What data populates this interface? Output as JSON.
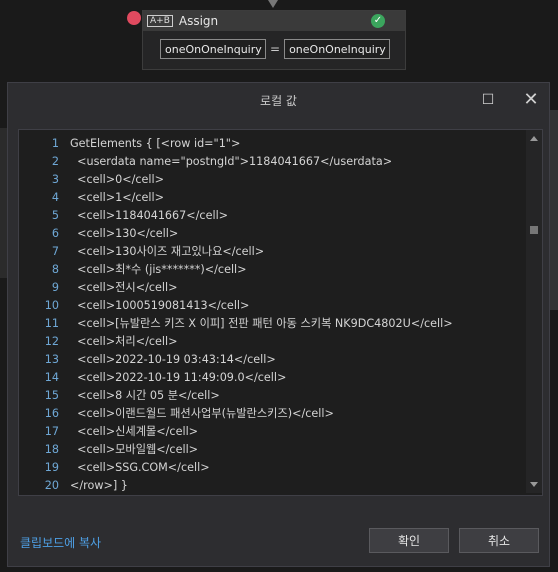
{
  "assign": {
    "icon_text": "A+B",
    "title": "Assign",
    "left_value": "oneOnOneInquiry",
    "equals": "=",
    "right_value": "oneOnOneInquiry"
  },
  "dialog": {
    "title": "로컬 값",
    "maximize_glyph": "☐",
    "close_glyph": "✕",
    "copy_link": "클립보드에 복사",
    "ok_label": "확인",
    "cancel_label": "취소"
  },
  "editor": {
    "lines": [
      {
        "n": "1",
        "t": "GetElements { [<row id=\"1\">"
      },
      {
        "n": "2",
        "t": "  <userdata name=\"postngId\">1184041667</userdata>"
      },
      {
        "n": "3",
        "t": "  <cell>0</cell>"
      },
      {
        "n": "4",
        "t": "  <cell>1</cell>"
      },
      {
        "n": "5",
        "t": "  <cell>1184041667</cell>"
      },
      {
        "n": "6",
        "t": "  <cell>130</cell>"
      },
      {
        "n": "7",
        "t": "  <cell>130사이즈 재고있나요</cell>"
      },
      {
        "n": "8",
        "t": "  <cell>최*수 (jis*******)</cell>"
      },
      {
        "n": "9",
        "t": "  <cell>전시</cell>"
      },
      {
        "n": "10",
        "t": "  <cell>1000519081413</cell>"
      },
      {
        "n": "11",
        "t": "  <cell>[뉴발란스 키즈 X 이피] 전판 패턴 아동 스키복 NK9DC4802U</cell>"
      },
      {
        "n": "12",
        "t": "  <cell>처리</cell>"
      },
      {
        "n": "13",
        "t": "  <cell>2022-10-19 03:43:14</cell>"
      },
      {
        "n": "14",
        "t": "  <cell>2022-10-19 11:49:09.0</cell>"
      },
      {
        "n": "15",
        "t": "  <cell>8 시간 05 분</cell>"
      },
      {
        "n": "16",
        "t": "  <cell>이랜드월드 패션사업부(뉴발란스키즈)</cell>"
      },
      {
        "n": "17",
        "t": "  <cell>신세계몰</cell>"
      },
      {
        "n": "18",
        "t": "  <cell>모바일웹</cell>"
      },
      {
        "n": "19",
        "t": "  <cell>SSG.COM</cell>"
      },
      {
        "n": "20",
        "t": "</row>] }"
      }
    ]
  },
  "colors": {
    "accent_link": "#4ea0e6",
    "ok_status": "#3ba55d",
    "breakpoint": "#e04a5f"
  },
  "icons": [
    "assign-icon",
    "check-icon",
    "breakpoint-dot",
    "maximize-icon",
    "close-icon",
    "scroll-up-arrow",
    "scroll-down-arrow"
  ]
}
